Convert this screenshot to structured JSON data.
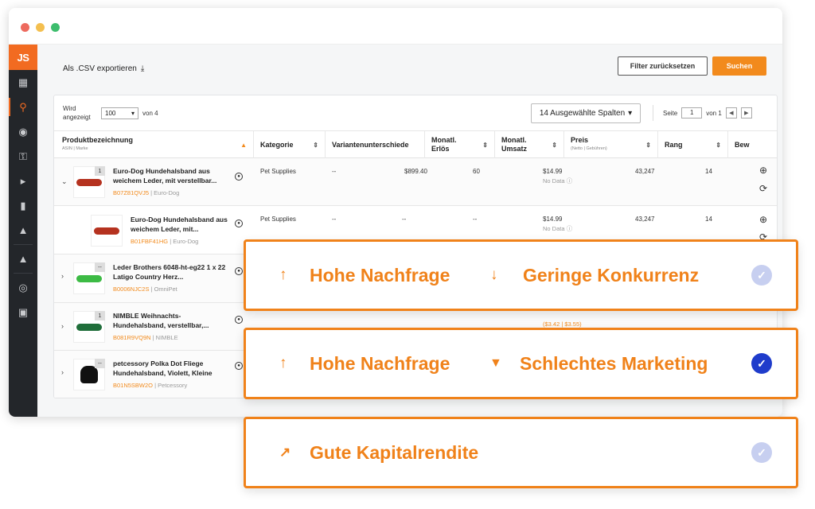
{
  "window": {
    "logo": "JS"
  },
  "sidebar": {
    "icons": [
      "store-icon",
      "search-icon",
      "binoculars-icon",
      "key-icon",
      "megaphone-icon",
      "chart-bars-icon",
      "graduation-cap-icon",
      "graduation-cap-icon",
      "globe-icon",
      "cart-icon"
    ]
  },
  "toolbar": {
    "export_label": "Als .CSV exportieren",
    "reset_label": "Filter zurücksetzen",
    "search_label": "Suchen"
  },
  "controls": {
    "shown_line1": "Wird",
    "shown_line2": "angezeigt",
    "per_page": "100",
    "of_label": "von 4",
    "columns_label": "14 Ausgewählte Spalten",
    "page_label": "Seite",
    "page_value": "1",
    "page_of": "von 1"
  },
  "table": {
    "headers": {
      "product": "Produktbezeichnung",
      "product_sub": "ASIN | Marke",
      "category": "Kategorie",
      "variants": "Variantenunterschiede",
      "revenue_1": "Monatl.",
      "revenue_2": "Erlös",
      "sales_1": "Monatl.",
      "sales_2": "Umsatz",
      "price": "Preis",
      "price_sub": "(Netto | Gebühren)",
      "rank": "Rang",
      "rating": "Bew"
    },
    "rows": [
      {
        "count": "1",
        "name": "Euro-Dog Hundehalsband aus weichem Leder, mit verstellbar...",
        "asin": "B07Z81QVJ5",
        "brand": "Euro-Dog",
        "category": "Pet Supplies",
        "variants": "--",
        "revenue": "$899.40",
        "sales": "60",
        "price": "$14.99",
        "price_sub": "No Data",
        "rank": "43,247",
        "rating": "14"
      },
      {
        "name": "Euro-Dog Hundehalsband aus weichem Leder, mit...",
        "asin": "B01FBF41HG",
        "brand": "Euro-Dog",
        "category": "Pet Supplies",
        "variants": "--",
        "revenue": "--",
        "sales": "--",
        "price": "$14.99",
        "price_sub": "No Data",
        "rank": "43,247",
        "rating": "14"
      },
      {
        "count": "--",
        "name": "Leder Brothers 6048-ht-eg22 1 x 22 Latigo Country Herz...",
        "asin": "B0006NJC2S",
        "brand": "OmniPet"
      },
      {
        "count": "1",
        "name": "NIMBLE Weihnachts-Hundehalsband, verstellbar,...",
        "asin": "B081R9VQ9N",
        "brand": "NIMBLE",
        "price_sub": "($3.42 | $3.55)"
      },
      {
        "count": "--",
        "name": "petcessory Polka Dot Fliege Hundehalsband, Violett, Kleine",
        "asin": "B01N5SBW2O",
        "brand": "Petcessory"
      }
    ]
  },
  "callouts": [
    {
      "a_label": "Hohe Nachfrage",
      "b_label": "Geringe Konkurrenz"
    },
    {
      "a_label": "Hohe Nachfrage",
      "b_label": "Schlechtes Marketing"
    },
    {
      "a_label": "Gute Kapitalrendite"
    }
  ],
  "colors": {
    "accent": "#f0821a",
    "sidebar": "#23262a",
    "check_active": "#1f3ccb",
    "check_inactive": "#c7cff0"
  }
}
